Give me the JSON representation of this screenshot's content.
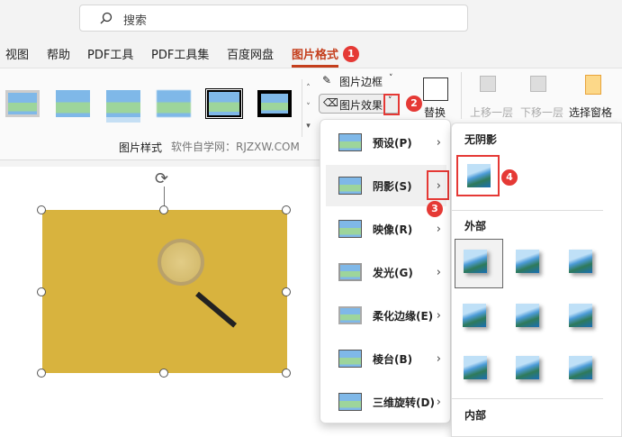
{
  "search": {
    "placeholder": "搜索",
    "icon": "search-icon"
  },
  "tabs": [
    {
      "label": "视图"
    },
    {
      "label": "帮助"
    },
    {
      "label": "PDF工具"
    },
    {
      "label": "PDF工具集"
    },
    {
      "label": "百度网盘"
    },
    {
      "label": "图片格式",
      "active": true
    }
  ],
  "ribbon": {
    "picture_border": "图片边框",
    "picture_effects": "图片效果",
    "replace": "替换",
    "bring_forward": "上移一层",
    "send_backward": "下移一层",
    "selection_pane": "选择窗格",
    "group_label": "图片样式",
    "watermark": "软件自学网：RJZXW.COM"
  },
  "effects_menu": [
    {
      "label": "预设(P)"
    },
    {
      "label": "阴影(S)",
      "highlighted": true
    },
    {
      "label": "映像(R)"
    },
    {
      "label": "发光(G)"
    },
    {
      "label": "柔化边缘(E)"
    },
    {
      "label": "棱台(B)"
    },
    {
      "label": "三维旋转(D)"
    }
  ],
  "shadow_menu": {
    "no_shadow": "无阴影",
    "outer": "外部",
    "inner": "内部"
  },
  "steps": [
    "1",
    "2",
    "3",
    "4"
  ],
  "colors": {
    "accent": "#c43e1c",
    "badge": "#e53935"
  }
}
